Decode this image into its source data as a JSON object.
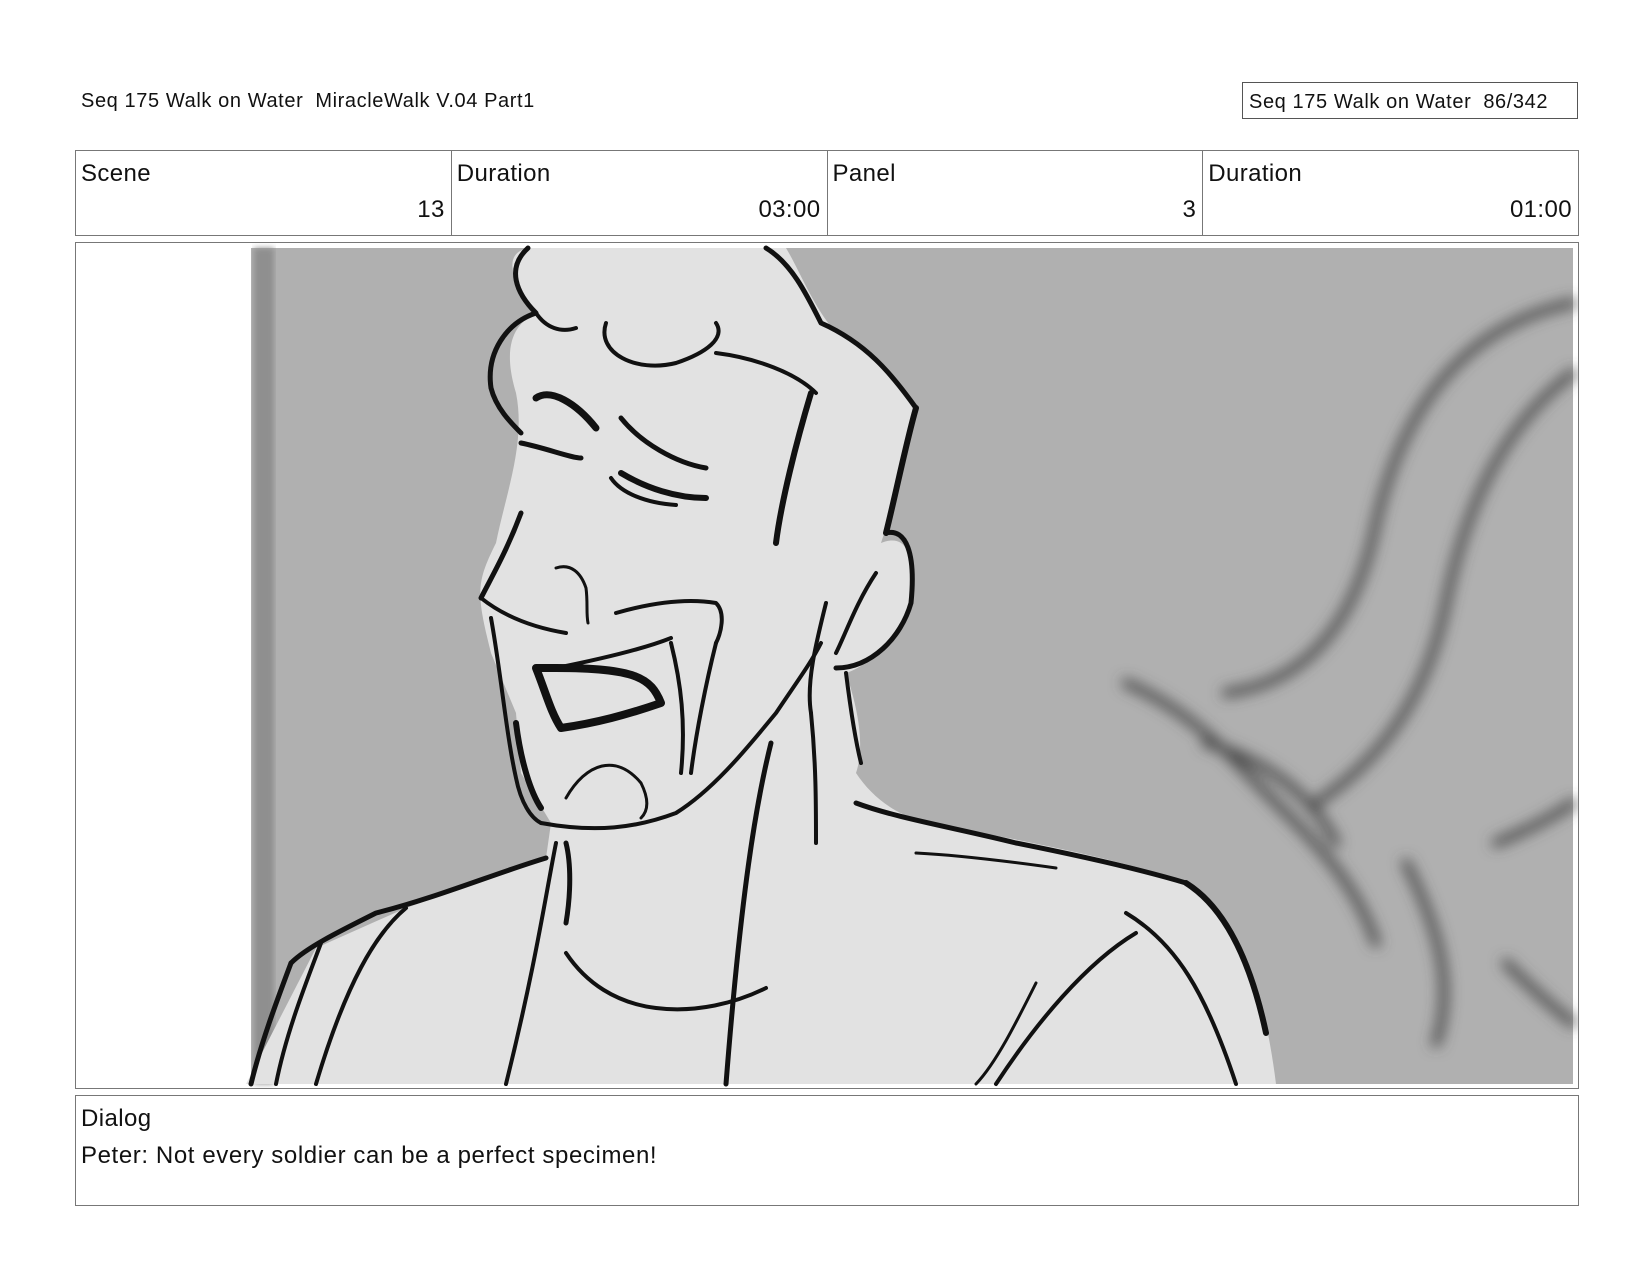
{
  "header": {
    "left_title": "Seq 175 Walk on Water",
    "left_version": "MiracleWalk V.04 Part1",
    "right_title": "Seq 175 Walk on Water",
    "right_page": "86/342"
  },
  "info": {
    "scene_label": "Scene",
    "scene_value": "13",
    "scene_duration_label": "Duration",
    "scene_duration_value": "03:00",
    "panel_label": "Panel",
    "panel_value": "3",
    "panel_duration_label": "Duration",
    "panel_duration_value": "01:00"
  },
  "dialog": {
    "label": "Dialog",
    "text": "Peter: Not every soldier can be a perfect specimen!"
  }
}
